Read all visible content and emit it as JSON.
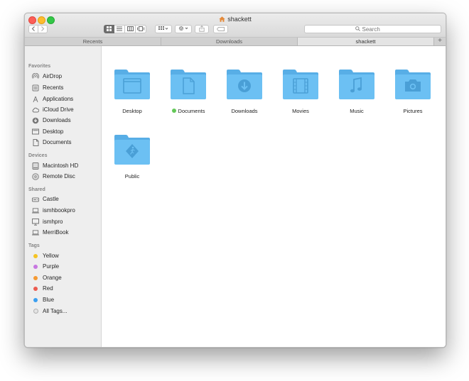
{
  "window": {
    "title": "shackett"
  },
  "toolbar": {
    "back_icon": "chevron-left-icon",
    "forward_icon": "chevron-right-icon",
    "active_view": "icons"
  },
  "search": {
    "placeholder": "Search"
  },
  "tabs": [
    {
      "label": "Recents",
      "active": false
    },
    {
      "label": "Downloads",
      "active": false
    },
    {
      "label": "shackett",
      "active": true
    }
  ],
  "sidebar": {
    "favorites": {
      "heading": "Favorites",
      "items": [
        {
          "label": "AirDrop",
          "icon": "airdrop-icon"
        },
        {
          "label": "Recents",
          "icon": "clock-icon"
        },
        {
          "label": "Applications",
          "icon": "applications-icon"
        },
        {
          "label": "iCloud Drive",
          "icon": "cloud-icon"
        },
        {
          "label": "Downloads",
          "icon": "download-icon"
        },
        {
          "label": "Desktop",
          "icon": "desktop-icon"
        },
        {
          "label": "Documents",
          "icon": "document-icon"
        }
      ]
    },
    "devices": {
      "heading": "Devices",
      "items": [
        {
          "label": "Macintosh HD",
          "icon": "hard-drive-icon"
        },
        {
          "label": "Remote Disc",
          "icon": "disc-icon"
        }
      ]
    },
    "shared": {
      "heading": "Shared",
      "items": [
        {
          "label": "Castle",
          "icon": "server-icon"
        },
        {
          "label": "ismhbookpro",
          "icon": "laptop-icon"
        },
        {
          "label": "ismhpro",
          "icon": "monitor-icon"
        },
        {
          "label": "MerriBook",
          "icon": "laptop-icon"
        }
      ]
    },
    "tags": {
      "heading": "Tags",
      "items": [
        {
          "label": "Yellow",
          "color": "#f5c322"
        },
        {
          "label": "Purple",
          "color": "#c777e0"
        },
        {
          "label": "Orange",
          "color": "#f59a33"
        },
        {
          "label": "Red",
          "color": "#ec5b4f"
        },
        {
          "label": "Blue",
          "color": "#3b9ff0"
        },
        {
          "label": "All Tags...",
          "color": "#e4e4e4"
        }
      ]
    }
  },
  "folders": [
    {
      "label": "Desktop",
      "icon": "desktop-folder-icon",
      "tag_color": ""
    },
    {
      "label": "Documents",
      "icon": "documents-folder-icon",
      "tag_color": "#64c858"
    },
    {
      "label": "Downloads",
      "icon": "downloads-folder-icon",
      "tag_color": ""
    },
    {
      "label": "Movies",
      "icon": "movies-folder-icon",
      "tag_color": ""
    },
    {
      "label": "Music",
      "icon": "music-folder-icon",
      "tag_color": ""
    },
    {
      "label": "Pictures",
      "icon": "pictures-folder-icon",
      "tag_color": ""
    },
    {
      "label": "Public",
      "icon": "public-folder-icon",
      "tag_color": ""
    }
  ],
  "colors": {
    "folder": "#6cc0f3",
    "folder_dark": "#58aee6",
    "folder_glyph": "#4a9fd6",
    "accent": "#6d6d6d"
  }
}
